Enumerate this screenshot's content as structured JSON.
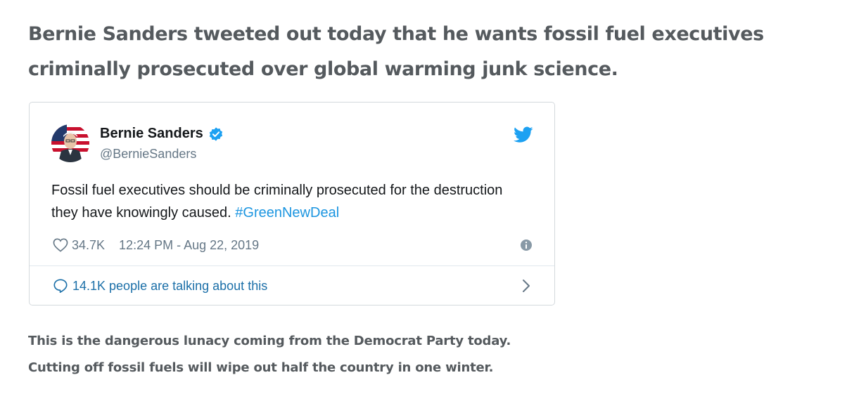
{
  "article": {
    "headline": "Bernie Sanders tweeted out today that he wants fossil fuel executives criminally prosecuted over global warming junk science.",
    "commentary": [
      "This is the dangerous lunacy coming from the Democrat Party today.",
      "Cutting off fossil fuels will wipe out half the country in one winter."
    ]
  },
  "tweet": {
    "author_name": "Bernie Sanders",
    "author_handle": "@BernieSanders",
    "text": "Fossil fuel executives should be criminally prosecuted for the destruction they have knowingly caused. ",
    "hashtag": "#GreenNewDeal",
    "like_count": "34.7K",
    "timestamp": "12:24 PM - Aug 22, 2019",
    "conversation_label": "14.1K people are talking about this",
    "icons": {
      "verified": "verified-badge-icon",
      "twitter": "twitter-bird-icon",
      "like": "heart-icon",
      "info": "info-icon",
      "conversation": "speech-bubble-icon",
      "chevron": "chevron-right-icon"
    },
    "colors": {
      "accent": "#1da1f2",
      "link": "#1b95e0",
      "muted": "#657786",
      "text": "#14171a"
    }
  }
}
